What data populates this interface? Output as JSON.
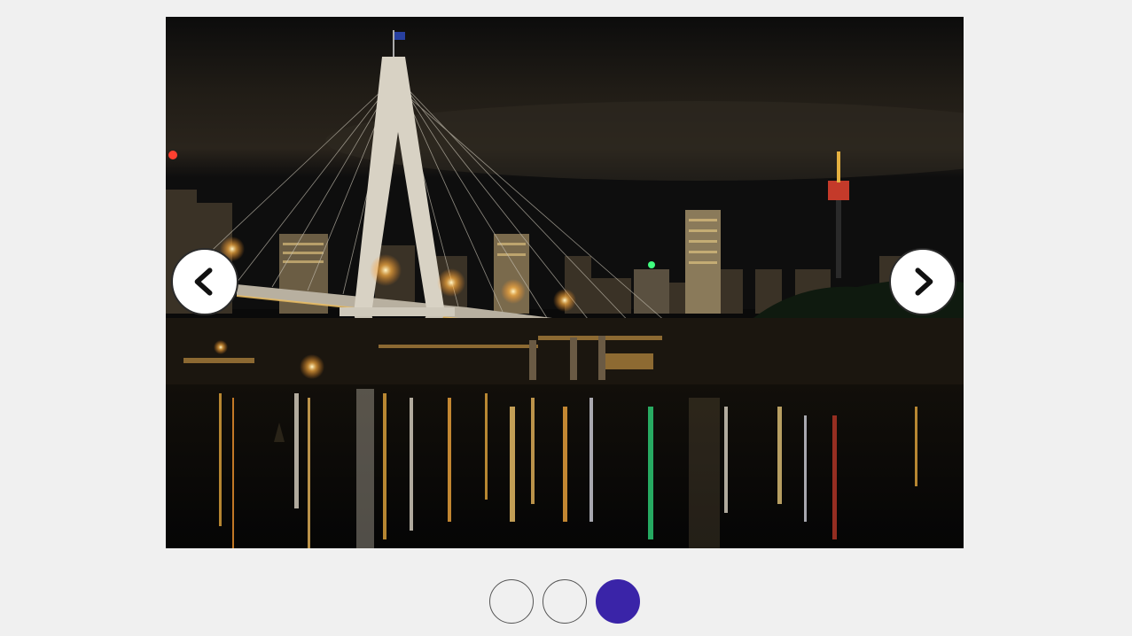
{
  "carousel": {
    "slide_count": 3,
    "active_index": 2,
    "image_subject": "night-city-bridge-photo",
    "prev_icon": "chevron-left-icon",
    "next_icon": "chevron-right-icon",
    "colors": {
      "active_dot": "#3a24a8",
      "inactive_dot_border": "#555555",
      "page_background": "#f0f0f0",
      "button_background": "#ffffff"
    }
  }
}
